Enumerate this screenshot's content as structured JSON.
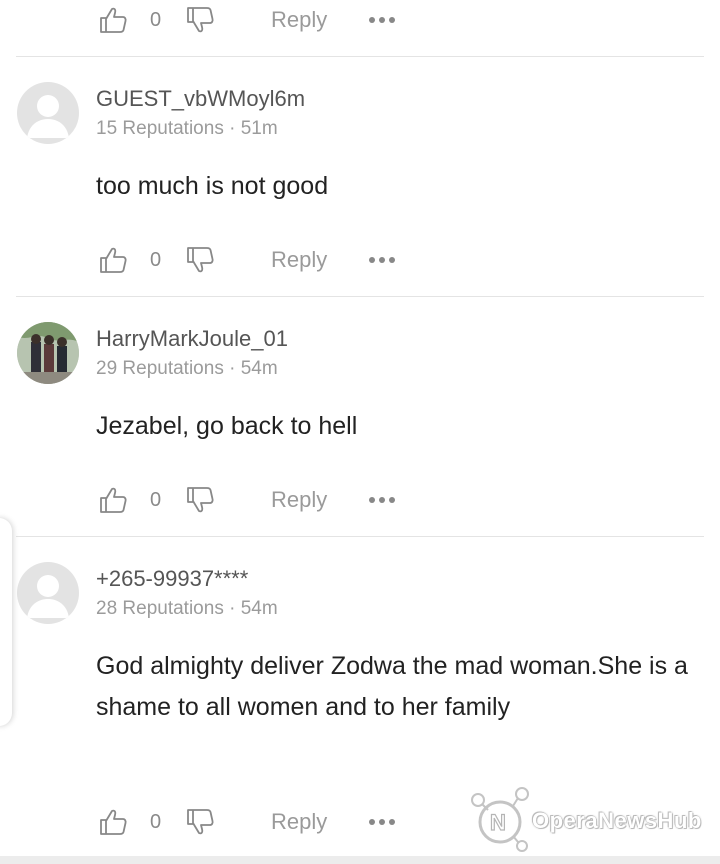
{
  "colors": {
    "text": "#222222",
    "muted": "#9b9b9b",
    "divider": "#e4e4e4",
    "avatar_bg": "#e3e3e3"
  },
  "top_actions": {
    "like_count": "0",
    "reply_label": "Reply"
  },
  "comments": [
    {
      "username": "GUEST_vbWMoyl6m",
      "reputation": "15 Reputations",
      "time": "51m",
      "text": "too much is not good",
      "like_count": "0",
      "reply_label": "Reply",
      "avatar_icon": "default-user-icon"
    },
    {
      "username": "HarryMarkJoule_01",
      "reputation": "29 Reputations",
      "time": "54m",
      "text": "Jezabel, go back to hell",
      "like_count": "0",
      "reply_label": "Reply",
      "avatar_icon": "photo-avatar"
    },
    {
      "username": "+265-99937****",
      "reputation": "28 Reputations",
      "time": "54m",
      "text": "God almighty deliver Zodwa the mad woman.She is a shame to all women and to her family",
      "like_count": "0",
      "reply_label": "Reply",
      "avatar_icon": "default-user-icon"
    }
  ],
  "watermark": {
    "text": "OperaNewsHub"
  }
}
